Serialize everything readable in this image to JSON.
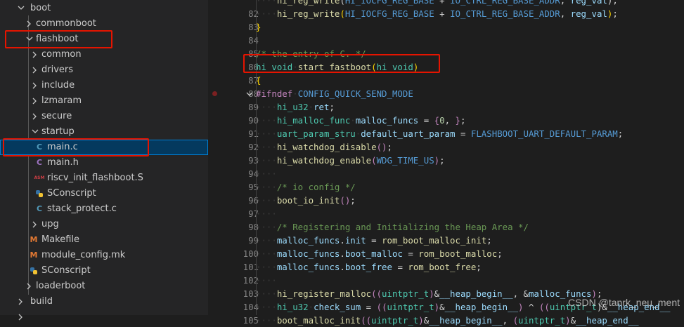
{
  "explorer": {
    "rows": [
      {
        "label": "boot",
        "type": "folder",
        "open": true,
        "depth": 1
      },
      {
        "label": "commonboot",
        "type": "folder",
        "open": false,
        "depth": 2
      },
      {
        "label": "flashboot",
        "type": "folder",
        "open": true,
        "depth": 2
      },
      {
        "label": "common",
        "type": "folder",
        "open": false,
        "depth": 3
      },
      {
        "label": "drivers",
        "type": "folder",
        "open": false,
        "depth": 3
      },
      {
        "label": "include",
        "type": "folder",
        "open": false,
        "depth": 3
      },
      {
        "label": "lzmaram",
        "type": "folder",
        "open": false,
        "depth": 3
      },
      {
        "label": "secure",
        "type": "folder",
        "open": false,
        "depth": 3
      },
      {
        "label": "startup",
        "type": "folder",
        "open": true,
        "depth": 3
      },
      {
        "label": "main.c",
        "type": "c",
        "depth": 4,
        "selected": true
      },
      {
        "label": "main.h",
        "type": "h",
        "depth": 4
      },
      {
        "label": "riscv_init_flashboot.S",
        "type": "asm",
        "depth": 4
      },
      {
        "label": "SConscript",
        "type": "python",
        "depth": 4
      },
      {
        "label": "stack_protect.c",
        "type": "c",
        "depth": 4
      },
      {
        "label": "upg",
        "type": "folder",
        "open": false,
        "depth": 3
      },
      {
        "label": "Makefile",
        "type": "make",
        "depth": 3
      },
      {
        "label": "module_config.mk",
        "type": "make",
        "depth": 3
      },
      {
        "label": "SConscript",
        "type": "python",
        "depth": 3
      },
      {
        "label": "loaderboot",
        "type": "folder",
        "open": false,
        "depth": 2
      },
      {
        "label": "build",
        "type": "folder",
        "open": false,
        "depth": 1
      },
      {
        "label": "",
        "type": "folder",
        "open": false,
        "depth": 1
      }
    ],
    "icon_glyphs": {
      "c": "C",
      "h": "C",
      "asm": "ASM",
      "make": "M"
    },
    "icon_colors": {
      "c": "#519aba",
      "h": "#a074c4",
      "asm": "#cc3e44",
      "python": "#3572a5",
      "make": "#e37933"
    }
  },
  "editor": {
    "lines": [
      {
        "n": "",
        "indent": 1,
        "toks": [
          [
            "fn",
            "hi_reg_write"
          ],
          [
            "pl",
            "("
          ],
          [
            "mac",
            "HI_IOCFG_REG_BASE"
          ],
          [
            "pl",
            " + "
          ],
          [
            "mac",
            "IO_CTRL_REG_BASE_ADDR"
          ],
          [
            "pl",
            ", "
          ],
          [
            "var",
            "reg_val"
          ],
          [
            "pl",
            ");"
          ]
        ]
      },
      {
        "n": "82",
        "indent": 1,
        "toks": [
          [
            "fn",
            "hi_reg_write"
          ],
          [
            "br",
            "("
          ],
          [
            "mac",
            "HI_IOCFG_REG_BASE"
          ],
          [
            "pl",
            " + "
          ],
          [
            "mac",
            "IO_CTRL_REG_BASE_ADDR"
          ],
          [
            "pl",
            ", "
          ],
          [
            "var",
            "reg_val"
          ],
          [
            "br",
            ")"
          ],
          [
            "pl",
            ";"
          ]
        ]
      },
      {
        "n": "83",
        "indent": 0,
        "toks": [
          [
            "br",
            "}"
          ]
        ]
      },
      {
        "n": "84",
        "indent": 0,
        "toks": []
      },
      {
        "n": "85",
        "indent": 0,
        "toks": [
          [
            "com",
            "/* the entry of C. */"
          ]
        ]
      },
      {
        "n": "86",
        "indent": 0,
        "toks": [
          [
            "ty",
            "hi_void"
          ],
          [
            "pl",
            " "
          ],
          [
            "fn",
            "start_fastboot"
          ],
          [
            "br",
            "("
          ],
          [
            "ty",
            "hi_void"
          ],
          [
            "br",
            ")"
          ]
        ]
      },
      {
        "n": "87",
        "indent": 0,
        "toks": [
          [
            "br",
            "{"
          ]
        ]
      },
      {
        "n": "88",
        "indent": 0,
        "fold": true,
        "bp": true,
        "toks": [
          [
            "pp",
            "#ifndef"
          ],
          [
            "pl",
            " "
          ],
          [
            "kw",
            "CONFIG_QUICK_SEND_MODE"
          ]
        ]
      },
      {
        "n": "89",
        "indent": 1,
        "toks": [
          [
            "ty",
            "hi_u32"
          ],
          [
            "pl",
            " "
          ],
          [
            "var",
            "ret"
          ],
          [
            "pl",
            ";"
          ]
        ]
      },
      {
        "n": "90",
        "indent": 1,
        "toks": [
          [
            "ty",
            "hi_malloc_func"
          ],
          [
            "pl",
            " "
          ],
          [
            "var",
            "malloc_funcs"
          ],
          [
            "pl",
            " = "
          ],
          [
            "pp",
            "{"
          ],
          [
            "num",
            "0"
          ],
          [
            "pl",
            ", "
          ],
          [
            "pp",
            "}"
          ],
          [
            "pl",
            ";"
          ]
        ]
      },
      {
        "n": "91",
        "indent": 1,
        "toks": [
          [
            "ty",
            "uart_param_stru"
          ],
          [
            "pl",
            " "
          ],
          [
            "var",
            "default_uart_param"
          ],
          [
            "pl",
            " = "
          ],
          [
            "mac",
            "FLASHBOOT_UART_DEFAULT_PARAM"
          ],
          [
            "pl",
            ";"
          ]
        ]
      },
      {
        "n": "92",
        "indent": 1,
        "toks": [
          [
            "fn",
            "hi_watchdog_disable"
          ],
          [
            "pp",
            "()"
          ],
          [
            "pl",
            ";"
          ]
        ]
      },
      {
        "n": "93",
        "indent": 1,
        "toks": [
          [
            "fn",
            "hi_watchdog_enable"
          ],
          [
            "pp",
            "("
          ],
          [
            "mac",
            "WDG_TIME_US"
          ],
          [
            "pp",
            ")"
          ],
          [
            "pl",
            ";"
          ]
        ]
      },
      {
        "n": "94",
        "indent": 1,
        "toks": []
      },
      {
        "n": "95",
        "indent": 1,
        "toks": [
          [
            "com",
            "/* io config */"
          ]
        ]
      },
      {
        "n": "96",
        "indent": 1,
        "toks": [
          [
            "fn",
            "boot_io_init"
          ],
          [
            "pp",
            "()"
          ],
          [
            "pl",
            ";"
          ]
        ]
      },
      {
        "n": "97",
        "indent": 1,
        "toks": []
      },
      {
        "n": "98",
        "indent": 1,
        "toks": [
          [
            "com",
            "/* Registering and Initializing the Heap Area */"
          ]
        ]
      },
      {
        "n": "99",
        "indent": 1,
        "toks": [
          [
            "var",
            "malloc_funcs"
          ],
          [
            "pl",
            "."
          ],
          [
            "var",
            "init"
          ],
          [
            "pl",
            " = "
          ],
          [
            "fn",
            "rom_boot_malloc_init"
          ],
          [
            "pl",
            ";"
          ]
        ]
      },
      {
        "n": "100",
        "indent": 1,
        "toks": [
          [
            "var",
            "malloc_funcs"
          ],
          [
            "pl",
            "."
          ],
          [
            "var",
            "boot_malloc"
          ],
          [
            "pl",
            " = "
          ],
          [
            "fn",
            "rom_boot_malloc"
          ],
          [
            "pl",
            ";"
          ]
        ]
      },
      {
        "n": "101",
        "indent": 1,
        "toks": [
          [
            "var",
            "malloc_funcs"
          ],
          [
            "pl",
            "."
          ],
          [
            "var",
            "boot_free"
          ],
          [
            "pl",
            " = "
          ],
          [
            "fn",
            "rom_boot_free"
          ],
          [
            "pl",
            ";"
          ]
        ]
      },
      {
        "n": "102",
        "indent": 1,
        "toks": []
      },
      {
        "n": "103",
        "indent": 1,
        "toks": [
          [
            "fn",
            "hi_register_malloc"
          ],
          [
            "pp",
            "(("
          ],
          [
            "ty",
            "uintptr_t"
          ],
          [
            "pp",
            ")"
          ],
          [
            "pl",
            "&"
          ],
          [
            "var",
            "__heap_begin__"
          ],
          [
            "pl",
            ", &"
          ],
          [
            "var",
            "malloc_funcs"
          ],
          [
            "pp",
            ")"
          ],
          [
            "pl",
            ";"
          ]
        ]
      },
      {
        "n": "104",
        "indent": 1,
        "toks": [
          [
            "ty",
            "hi_u32"
          ],
          [
            "pl",
            " "
          ],
          [
            "var",
            "check_sum"
          ],
          [
            "pl",
            " = "
          ],
          [
            "pp",
            "(("
          ],
          [
            "ty",
            "uintptr_t"
          ],
          [
            "pp",
            ")"
          ],
          [
            "pl",
            "&"
          ],
          [
            "var",
            "__heap_begin__"
          ],
          [
            "pp",
            ")"
          ],
          [
            "pl",
            " ^ "
          ],
          [
            "pp",
            "(("
          ],
          [
            "ty",
            "uintptr_t"
          ],
          [
            "pl",
            ")&"
          ],
          [
            "var",
            "__heap_end__"
          ]
        ]
      },
      {
        "n": "105",
        "indent": 1,
        "toks": [
          [
            "fn",
            "boot_malloc_init"
          ],
          [
            "pp",
            "(("
          ],
          [
            "ty",
            "uintptr_t"
          ],
          [
            "pp",
            ")"
          ],
          [
            "pl",
            "&"
          ],
          [
            "var",
            "__heap_begin__"
          ],
          [
            "pl",
            ", "
          ],
          [
            "pp",
            "("
          ],
          [
            "ty",
            "uintptr_t"
          ],
          [
            "pp",
            ")"
          ],
          [
            "pl",
            "&"
          ],
          [
            "var",
            "__heap_end__"
          ]
        ]
      }
    ]
  },
  "watermark": "CSDN @tanrk_neu_ment"
}
